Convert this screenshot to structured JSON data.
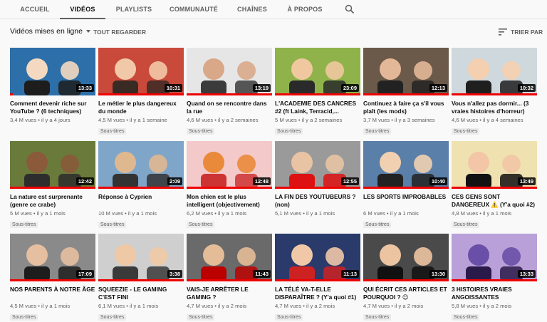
{
  "tabs": [
    {
      "label": "ACCUEIL",
      "active": false
    },
    {
      "label": "VIDÉOS",
      "active": true
    },
    {
      "label": "PLAYLISTS",
      "active": false
    },
    {
      "label": "COMMUNAUTÉ",
      "active": false
    },
    {
      "label": "CHAÎNES",
      "active": false
    },
    {
      "label": "À PROPOS",
      "active": false
    }
  ],
  "toolbar": {
    "sort_select": "Vidéos mises en ligne",
    "play_all": "TOUT REGARDER",
    "sort_by": "TRIER PAR"
  },
  "colors": {
    "accent": "#e00000",
    "text": "#0d0d0d",
    "muted": "#606060",
    "badge_bg": "#ececec"
  },
  "videos": [
    {
      "title": "Comment devenir riche sur YouTube ? (6 techniques)",
      "meta": "3,4 M vues • il y a 4 jours",
      "duration": "13:33",
      "badge": "",
      "progress": 0.03
    },
    {
      "title": "Le métier le plus dangereux du monde",
      "meta": "4,5 M vues • il y a 1 semaine",
      "duration": "10:31",
      "badge": "Sous-titres",
      "progress": 1
    },
    {
      "title": "Quand on se rencontre dans la rue",
      "meta": "4,6 M vues • il y a 2 semaines",
      "duration": "13:19",
      "badge": "Sous-titres",
      "progress": 1
    },
    {
      "title": "L'ACADEMIE DES CANCRES #2 (ft Laink, Terracid,...",
      "meta": "5 M vues • il y a 2 semaines",
      "duration": "23:09",
      "badge": "Sous-titres",
      "progress": 1
    },
    {
      "title": "Continuez à faire ça s'il vous plaît (les mods)",
      "meta": "3,7 M vues • il y a 3 semaines",
      "duration": "12:13",
      "badge": "Sous-titres",
      "progress": 1
    },
    {
      "title": "Vous n'allez pas dormir... (3 vraies histoires d'horreur)",
      "meta": "4,6 M vues • il y a 4 semaines",
      "duration": "10:32",
      "badge": "Sous-titres",
      "progress": 1
    },
    {
      "title": "La nature est surprenante (genre ce crabe)",
      "meta": "5 M vues • il y a 1 mois",
      "duration": "12:42",
      "badge": "Sous-titres",
      "progress": 1
    },
    {
      "title": "Réponse à Cyprien",
      "meta": "10 M vues • il y a 1 mois",
      "duration": "2:09",
      "badge": "Sous-titres",
      "progress": 1
    },
    {
      "title": "Mon chien est le plus intelligent (objectivement)",
      "meta": "6,2 M vues • il y a 1 mois",
      "duration": "12:48",
      "badge": "Sous-titres",
      "progress": 1
    },
    {
      "title": "LA FIN DES YOUTUBEURS ? (non)",
      "meta": "5,1 M vues • il y a 1 mois",
      "duration": "12:55",
      "badge": "",
      "progress": 1
    },
    {
      "title": "LES SPORTS IMPROBABLES",
      "meta": "6 M vues • il y a 1 mois",
      "duration": "10:40",
      "badge": "Sous-titres",
      "progress": 1
    },
    {
      "title": "CES GENS SONT DANGEREUX ⚠️ (Y'a quoi #2)",
      "meta": "4,8 M vues • il y a 1 mois",
      "duration": "13:49",
      "badge": "Sous-titres",
      "progress": 1
    },
    {
      "title": "NOS PARENTS À NOTRE ÂGE",
      "meta": "4,5 M vues • il y a 1 mois",
      "duration": "17:09",
      "badge": "Sous-titres",
      "progress": 1
    },
    {
      "title": "SQUEEZIE - LE GAMING C'EST FINI",
      "meta": "6,1 M vues • il y a 1 mois",
      "duration": "3:38",
      "badge": "Sous-titres",
      "progress": 1
    },
    {
      "title": "VAIS-JE ARRÊTER LE GAMING ?",
      "meta": "4,7 M vues • il y a 2 mois",
      "duration": "11:43",
      "badge": "Sous-titres",
      "progress": 1
    },
    {
      "title": "LA TÉLÉ VA-T-ELLE DISPARAÎTRE ? (Y'a quoi #1)",
      "meta": "4,7 M vues • il y a 2 mois",
      "duration": "11:13",
      "badge": "Sous-titres",
      "progress": 1
    },
    {
      "title": "QUI ÉCRIT CES ARTICLES ET POURQUOI ? 😊",
      "meta": "4,7 M vues • il y a 2 mois",
      "duration": "13:30",
      "badge": "Sous-titres",
      "progress": 1
    },
    {
      "title": "3 HISTOIRES VRAIES ANGOISSANTES",
      "meta": "5,8 M vues • il y a 2 mois",
      "duration": "13:33",
      "badge": "Sous-titres",
      "progress": 1
    }
  ]
}
